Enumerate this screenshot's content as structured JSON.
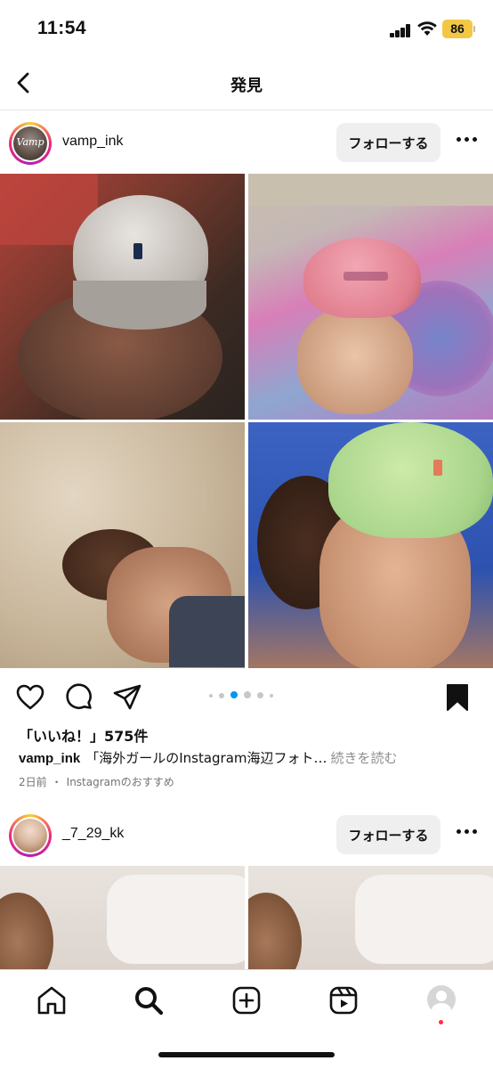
{
  "status_bar": {
    "time": "11:54",
    "battery": "86"
  },
  "header": {
    "title": "発見",
    "back_icon": "chevron-left-icon"
  },
  "posts": [
    {
      "username": "vamp_ink",
      "avatar_text": "Vamp",
      "follow_label": "フォローする",
      "likes": "「いいね！」575件",
      "caption_user": "vamp_ink",
      "caption_text": "「海外ガールのInstagram海辺フォト…",
      "caption_more": "続きを読む",
      "time_ago": "2日前",
      "meta_sep": "・",
      "source": "Instagramのおすすめ",
      "carousel": {
        "total": 6,
        "active": 2
      },
      "saved": true
    },
    {
      "username": "_7_29_kk",
      "follow_label": "フォローする"
    }
  ],
  "tab_bar": {
    "items": [
      "home-icon",
      "search-icon",
      "create-icon",
      "reels-icon",
      "profile-avatar"
    ]
  },
  "colors": {
    "follow_bg": "#efefef",
    "active_dot": "#0095f6",
    "notification": "#ff3040"
  }
}
